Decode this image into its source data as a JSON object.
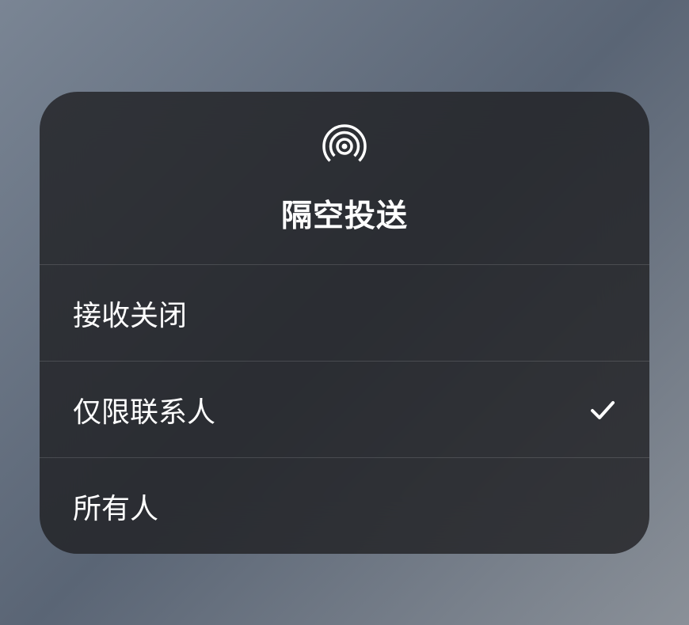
{
  "title": "隔空投送",
  "options": [
    {
      "label": "接收关闭",
      "selected": false
    },
    {
      "label": "仅限联系人",
      "selected": true
    },
    {
      "label": "所有人",
      "selected": false
    }
  ]
}
